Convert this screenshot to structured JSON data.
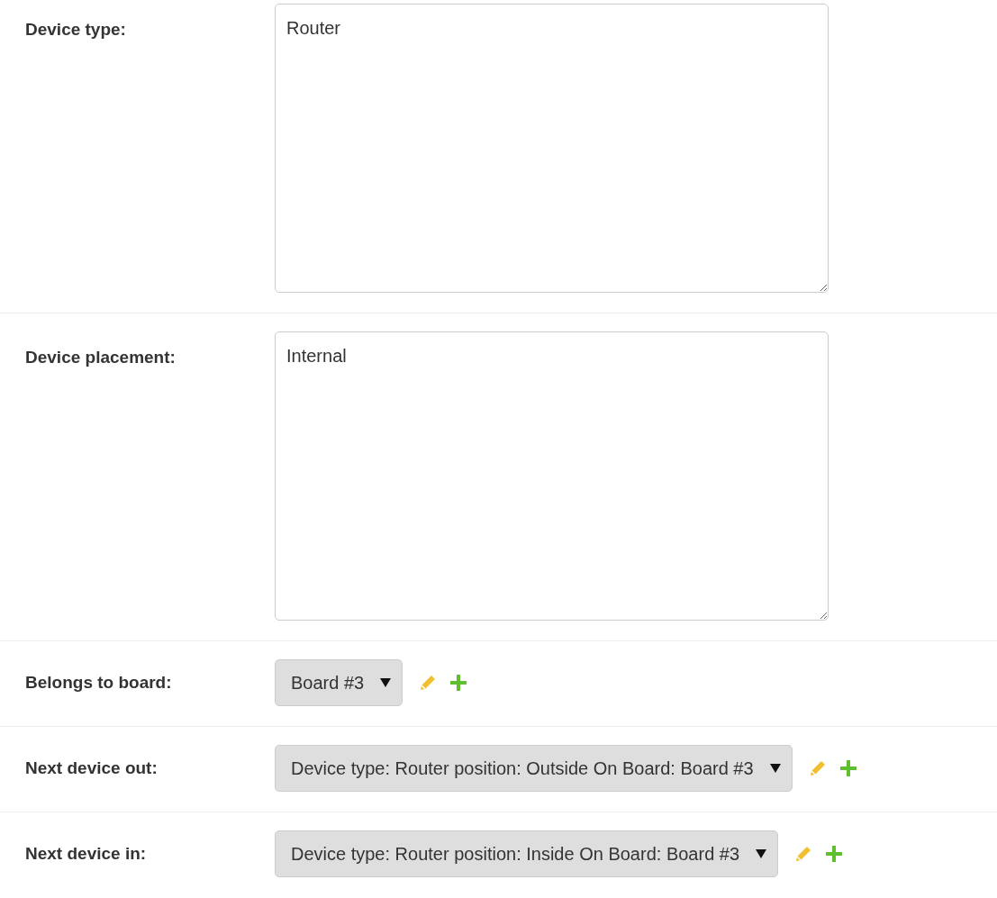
{
  "fields": [
    {
      "kind": "textarea",
      "label": "Device type:",
      "value": "Router"
    },
    {
      "kind": "textarea",
      "label": "Device placement:",
      "value": "Internal"
    },
    {
      "kind": "select",
      "label": "Belongs to board:",
      "value": "Board #3"
    },
    {
      "kind": "select",
      "label": "Next device out:",
      "value": "Device type: Router position: Outside On Board: Board #3"
    },
    {
      "kind": "select",
      "label": "Next device in:",
      "value": "Device type: Router position: Inside On Board: Board #3"
    }
  ]
}
